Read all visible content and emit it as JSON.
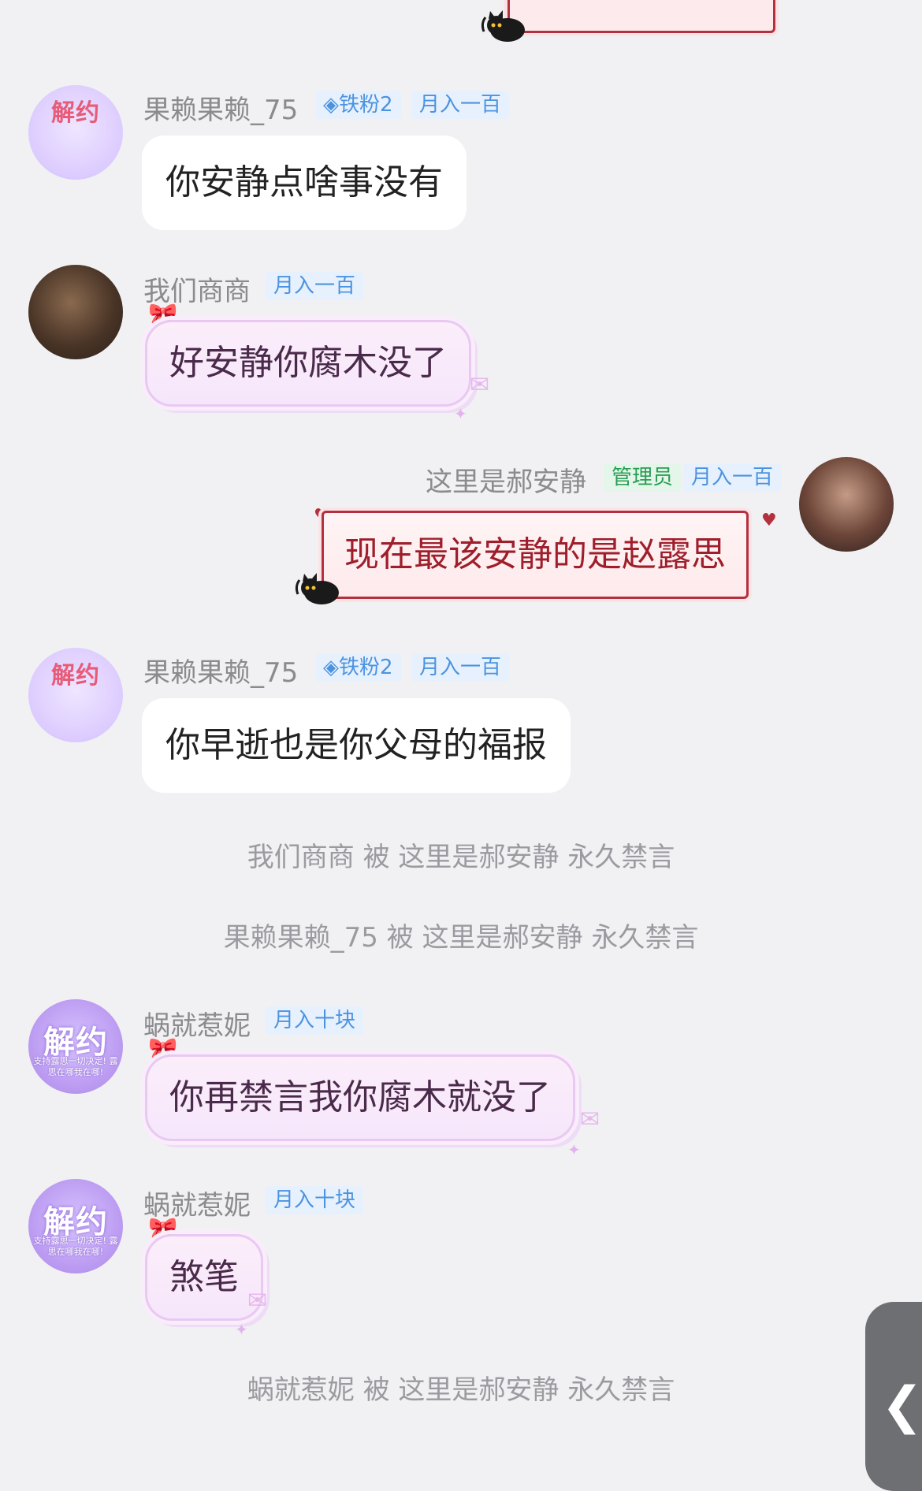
{
  "messages": [
    {
      "user": "果赖果赖_75",
      "badges": [
        "铁粉2",
        "月入一百"
      ],
      "text": "你安静点啥事没有",
      "avatar_text": "解约"
    },
    {
      "user": "我们商商",
      "badges": [
        "月入一百"
      ],
      "text": "好安静你腐木没了"
    },
    {
      "user": "这里是郝安静",
      "badges": [
        "管理员",
        "月入一百"
      ],
      "text": "现在最该安静的是赵露思"
    },
    {
      "user": "果赖果赖_75",
      "badges": [
        "铁粉2",
        "月入一百"
      ],
      "text": "你早逝也是你父母的福报",
      "avatar_text": "解约"
    },
    {
      "user": "蜗就惹妮",
      "badges": [
        "月入十块"
      ],
      "text": "你再禁言我你腐木就没了",
      "avatar_text": "解约",
      "avatar_subtext": "支持露思一切决定! 露思在哪我在哪!"
    },
    {
      "user": "蜗就惹妮",
      "badges": [
        "月入十块"
      ],
      "text": "煞笔",
      "avatar_text": "解约",
      "avatar_subtext": "支持露思一切决定! 露思在哪我在哪!"
    }
  ],
  "system": [
    "我们商商 被 这里是郝安静 永久禁言",
    "果赖果赖_75 被 这里是郝安静 永久禁言",
    "蜗就惹妮 被 这里是郝安静 永久禁言"
  ],
  "icons": {
    "side_handle": "chevron-left-icon",
    "badge_diamond": "diamond-icon",
    "cat_sticker": "black-cat-icon"
  },
  "colors": {
    "background": "#f1f1f3",
    "badge_blue_text": "#4b93e0",
    "admin_badge_text": "#2a9d55",
    "red_bubble_text": "#9e1f2b"
  }
}
